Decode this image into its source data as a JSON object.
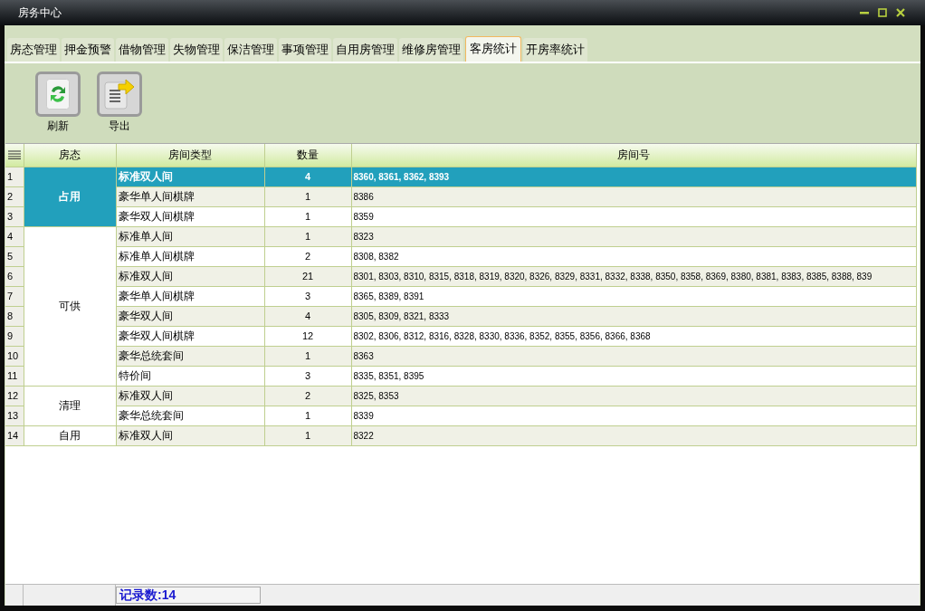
{
  "window": {
    "title": "房务中心"
  },
  "tabs": [
    {
      "label": "房态管理",
      "selected": false
    },
    {
      "label": "押金预警",
      "selected": false
    },
    {
      "label": "借物管理",
      "selected": false
    },
    {
      "label": "失物管理",
      "selected": false
    },
    {
      "label": "保洁管理",
      "selected": false
    },
    {
      "label": "事项管理",
      "selected": false
    },
    {
      "label": "自用房管理",
      "selected": false
    },
    {
      "label": "维修房管理",
      "selected": false
    },
    {
      "label": "客房统计",
      "selected": true
    },
    {
      "label": "开房率统计",
      "selected": false
    }
  ],
  "toolbar": [
    {
      "kind": "refresh",
      "label": "刷新"
    },
    {
      "kind": "export",
      "label": "导出"
    }
  ],
  "table": {
    "columns": [
      "房态",
      "房间类型",
      "数量",
      "房间号"
    ],
    "groups": [
      {
        "status": "占用",
        "rows": [
          {
            "index": "1",
            "type": "标准双人间",
            "count": "4",
            "rooms": "8360, 8361, 8362, 8393",
            "selected": true
          },
          {
            "index": "2",
            "type": "豪华单人间棋牌",
            "count": "1",
            "rooms": "8386",
            "selected": false
          },
          {
            "index": "3",
            "type": "豪华双人间棋牌",
            "count": "1",
            "rooms": "8359",
            "selected": false
          }
        ]
      },
      {
        "status": "可供",
        "rows": [
          {
            "index": "4",
            "type": "标准单人间",
            "count": "1",
            "rooms": "8323",
            "selected": false
          },
          {
            "index": "5",
            "type": "标准单人间棋牌",
            "count": "2",
            "rooms": "8308, 8382",
            "selected": false
          },
          {
            "index": "6",
            "type": "标准双人间",
            "count": "21",
            "rooms": "8301, 8303, 8310, 8315, 8318, 8319, 8320, 8326, 8329, 8331, 8332, 8338, 8350, 8358, 8369, 8380, 8381, 8383, 8385, 8388, 839",
            "selected": false
          },
          {
            "index": "7",
            "type": "豪华单人间棋牌",
            "count": "3",
            "rooms": "8365, 8389, 8391",
            "selected": false
          },
          {
            "index": "8",
            "type": "豪华双人间",
            "count": "4",
            "rooms": "8305, 8309, 8321, 8333",
            "selected": false
          },
          {
            "index": "9",
            "type": "豪华双人间棋牌",
            "count": "12",
            "rooms": "8302, 8306, 8312, 8316, 8328, 8330, 8336, 8352, 8355, 8356, 8366, 8368",
            "selected": false
          },
          {
            "index": "10",
            "type": "豪华总统套间",
            "count": "1",
            "rooms": "8363",
            "selected": false
          },
          {
            "index": "11",
            "type": "特价间",
            "count": "3",
            "rooms": "8335, 8351, 8395",
            "selected": false
          }
        ]
      },
      {
        "status": "清理",
        "rows": [
          {
            "index": "12",
            "type": "标准双人间",
            "count": "2",
            "rooms": "8325, 8353",
            "selected": false
          },
          {
            "index": "13",
            "type": "豪华总统套间",
            "count": "1",
            "rooms": "8339",
            "selected": false
          }
        ]
      },
      {
        "status": "自用",
        "rows": [
          {
            "index": "14",
            "type": "标准双人间",
            "count": "1",
            "rooms": "8322",
            "selected": false
          }
        ]
      }
    ]
  },
  "footer": {
    "record_count": "记录数:14"
  }
}
